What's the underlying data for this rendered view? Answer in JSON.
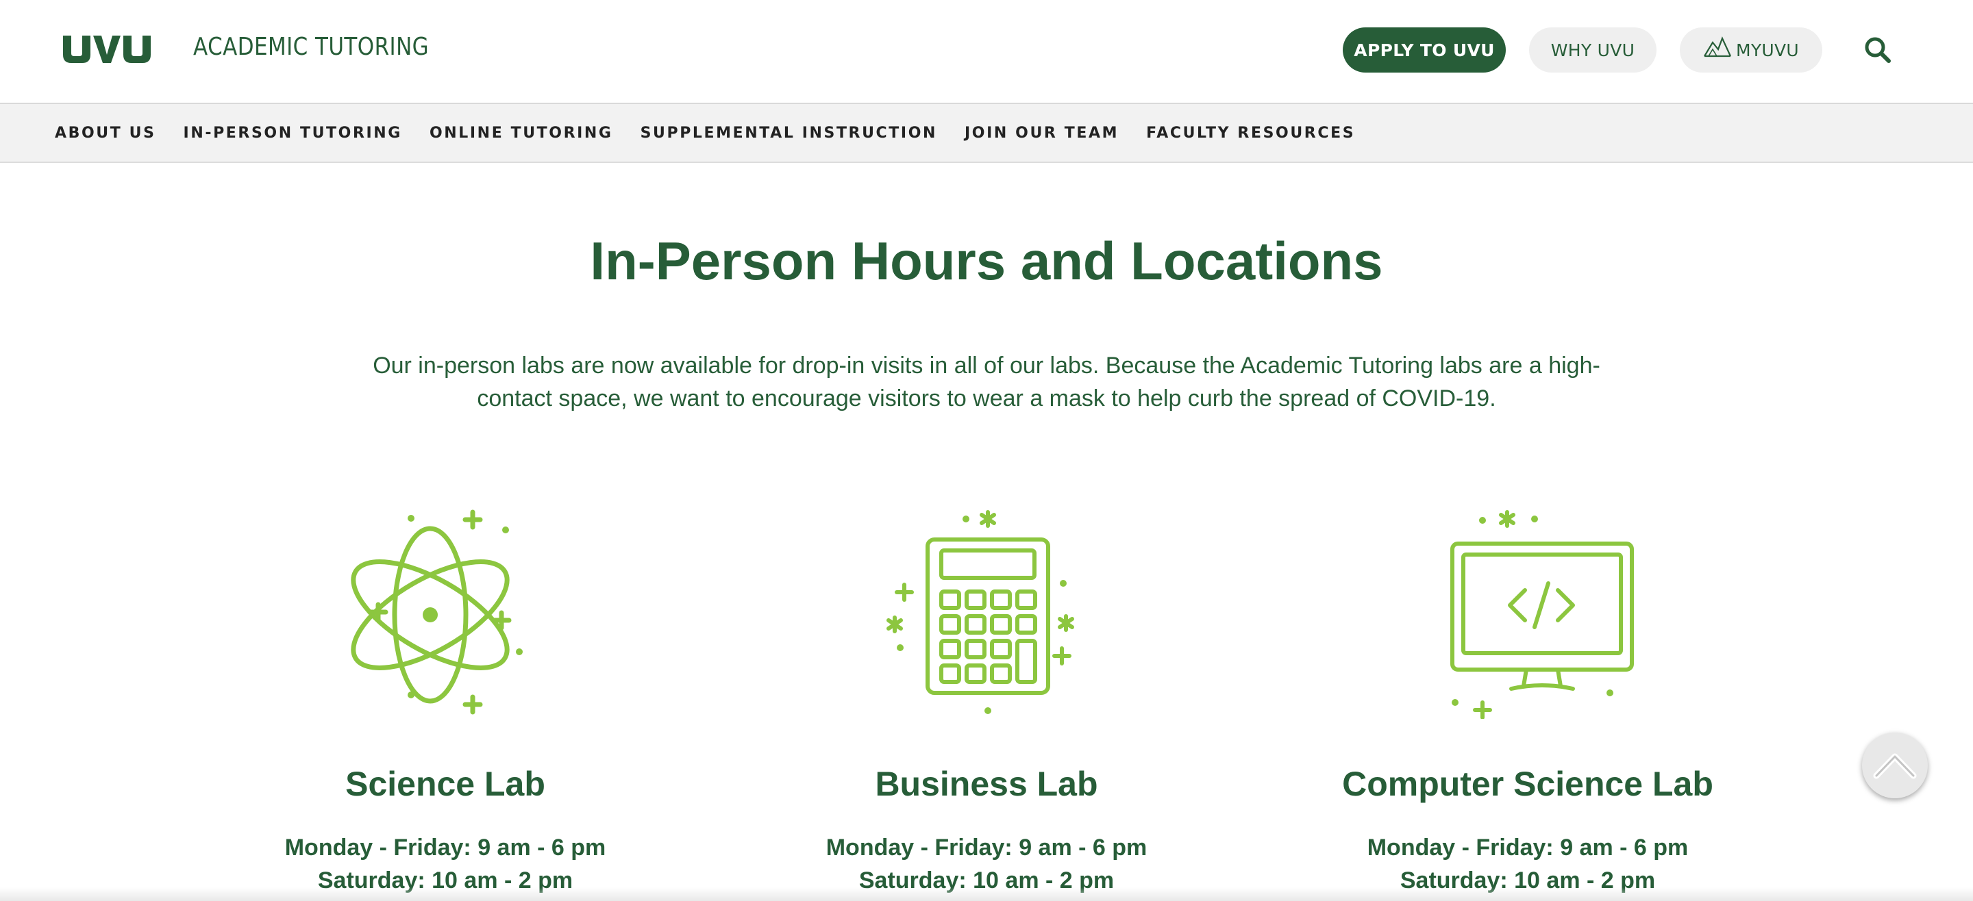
{
  "header": {
    "logo_text": "UVU",
    "site_title": "ACADEMIC TUTORING",
    "apply_label": "APPLY TO UVU",
    "why_label": "WHY UVU",
    "myuvu_label": "MYUVU",
    "search_icon": "search-icon"
  },
  "nav": {
    "items": [
      {
        "label": "ABOUT US"
      },
      {
        "label": "IN-PERSON TUTORING"
      },
      {
        "label": "ONLINE TUTORING"
      },
      {
        "label": "SUPPLEMENTAL INSTRUCTION"
      },
      {
        "label": "JOIN OUR TEAM"
      },
      {
        "label": "FACULTY RESOURCES"
      }
    ]
  },
  "main": {
    "title": "In-Person Hours and Locations",
    "intro": "Our in-person labs are now available for drop-in visits in all of our labs. Because the Academic Tutoring labs are a high-contact space, we want to encourage visitors to wear a mask to help curb the spread of COVID-19.",
    "labs": [
      {
        "name": "Science Lab",
        "icon": "atom-icon",
        "hours_weekday": "Monday - Friday: 9 am - 6 pm",
        "hours_saturday": "Saturday: 10 am - 2 pm"
      },
      {
        "name": "Business Lab",
        "icon": "calculator-icon",
        "hours_weekday": "Monday - Friday: 9 am - 6 pm",
        "hours_saturday": "Saturday: 10 am - 2 pm"
      },
      {
        "name": "Computer Science Lab",
        "icon": "computer-code-icon",
        "hours_weekday": "Monday - Friday: 9 am - 6 pm",
        "hours_saturday": "Saturday: 10 am - 2 pm"
      }
    ]
  },
  "colors": {
    "brand_green": "#275d38",
    "icon_green": "#8cc63f",
    "nav_bg": "#f2f2f2"
  },
  "back_to_top_icon": "chevron-up-icon"
}
